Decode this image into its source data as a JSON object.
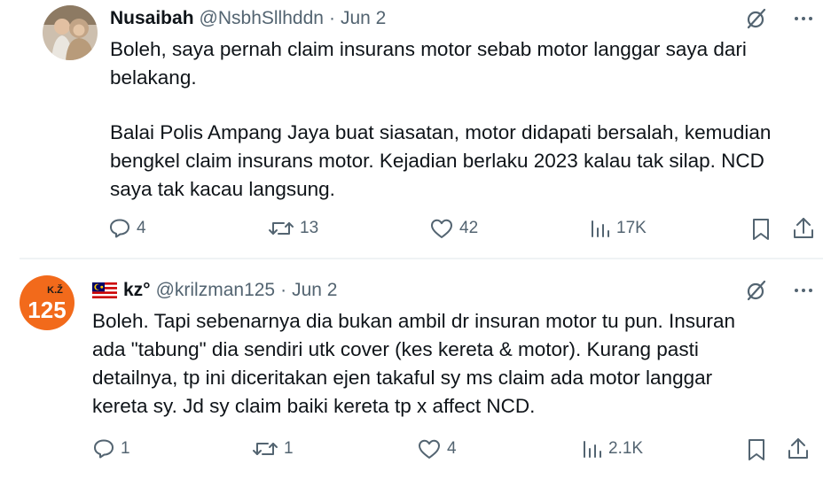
{
  "tweets": [
    {
      "author_name": "Nusaibah",
      "handle": "@NsbhSllhddn",
      "dot": "·",
      "date": "Jun 2",
      "lines": [
        "Boleh, saya pernah claim insurans motor sebab motor langgar saya dari",
        "belakang.",
        "",
        "Balai Polis Ampang Jaya buat siasatan, motor didapati bersalah, kemudian",
        "bengkel claim insurans motor. Kejadian berlaku 2023 kalau tak silap. NCD",
        "saya tak kacau langsung."
      ],
      "replies": "4",
      "reposts": "13",
      "likes": "42",
      "views": "17K"
    },
    {
      "author_name": "kz°",
      "handle": "@krilzman125",
      "dot": "·",
      "date": "Jun 2",
      "flag": "malaysia-flag",
      "avatar_text_top": "K.Ž",
      "avatar_text_main": "125",
      "lines": [
        "Boleh. Tapi sebenarnya dia bukan ambil dr insuran motor tu pun. Insuran",
        "ada \"tabung\" dia sendiri utk cover (kes kereta & motor). Kurang pasti",
        "detailnya, tp ini diceritakan ejen takaful sy ms claim ada motor langgar",
        "kereta sy. Jd sy claim baiki kereta tp x affect NCD."
      ],
      "replies": "1",
      "reposts": "1",
      "likes": "4",
      "views": "2.1K"
    }
  ],
  "colors": {
    "text": "#0f1419",
    "secondary": "#536471",
    "separator": "#eff3f4",
    "avatar2_bg": "#f26a1b"
  },
  "icons": [
    "reply-icon",
    "repost-icon",
    "like-icon",
    "views-icon",
    "bookmark-icon",
    "share-icon",
    "grok-icon",
    "more-icon"
  ]
}
